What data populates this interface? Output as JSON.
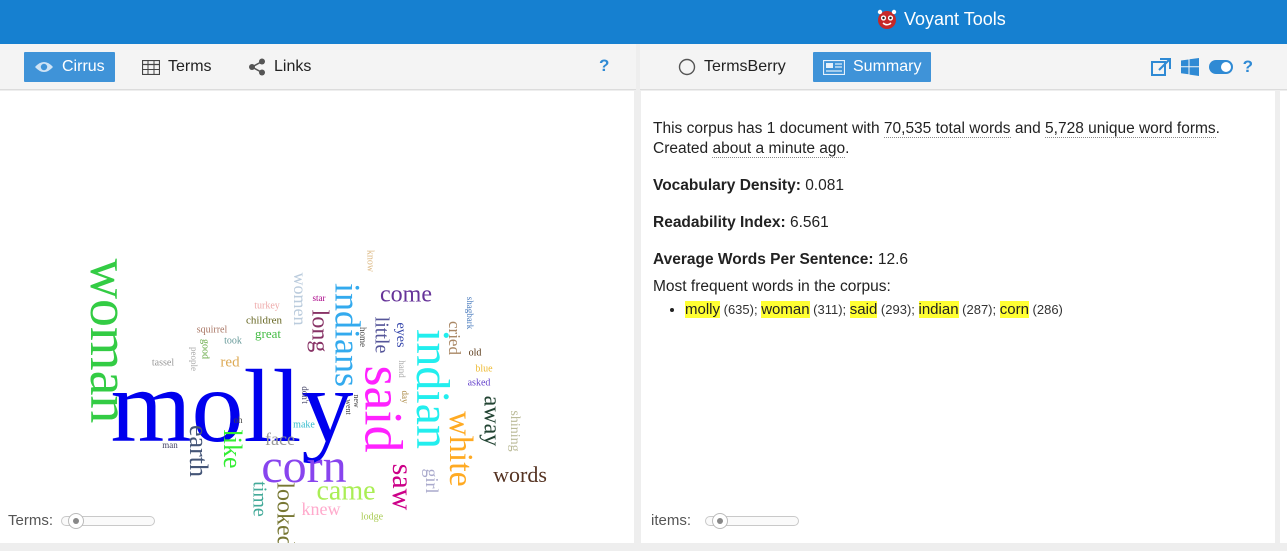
{
  "app": {
    "title": "Voyant Tools"
  },
  "left_toolbar": {
    "tabs": [
      {
        "label": "Cirrus",
        "active": true,
        "icon": "eye-icon"
      },
      {
        "label": "Terms",
        "active": false,
        "icon": "table-icon"
      },
      {
        "label": "Links",
        "active": false,
        "icon": "share-icon"
      }
    ],
    "help": "?"
  },
  "right_toolbar": {
    "tabs": [
      {
        "label": "TermsBerry",
        "active": false,
        "icon": "circle-icon"
      },
      {
        "label": "Summary",
        "active": true,
        "icon": "newspaper-icon"
      }
    ],
    "icons": [
      "export-icon",
      "windows-icon",
      "toggle-icon",
      "help-icon"
    ],
    "help": "?"
  },
  "cirrus": {
    "slider_label": "Terms:",
    "slider_value": 0.05,
    "words": [
      {
        "text": "molly",
        "color": "#0000ee"
      },
      {
        "text": "woman",
        "color": "#33cc44"
      },
      {
        "text": "said",
        "color": "#ff22ff"
      },
      {
        "text": "indian",
        "color": "#22eeee"
      },
      {
        "text": "corn",
        "color": "#8844ee"
      },
      {
        "text": "indians",
        "color": "#33aaee"
      },
      {
        "text": "white",
        "color": "#ffaa22"
      },
      {
        "text": "saw",
        "color": "#cc0088"
      },
      {
        "text": "came",
        "color": "#aaee55"
      },
      {
        "text": "like",
        "color": "#33ee33"
      },
      {
        "text": "earth",
        "color": "#445577"
      },
      {
        "text": "long",
        "color": "#883366"
      },
      {
        "text": "looked",
        "color": "#777733"
      },
      {
        "text": "come",
        "color": "#663399"
      },
      {
        "text": "words",
        "color": "#553322"
      },
      {
        "text": "away",
        "color": "#224433"
      },
      {
        "text": "little",
        "color": "#555599"
      },
      {
        "text": "face",
        "color": "#999999"
      },
      {
        "text": "time",
        "color": "#44aa99"
      },
      {
        "text": "knew",
        "color": "#ffaacc"
      },
      {
        "text": "girl",
        "color": "#aaaacc"
      },
      {
        "text": "cried",
        "color": "#aa8866"
      },
      {
        "text": "women",
        "color": "#bbccdd"
      },
      {
        "text": "eyes",
        "color": "#3344aa"
      },
      {
        "text": "shining",
        "color": "#bbbb99"
      },
      {
        "text": "red",
        "color": "#ddaa55"
      },
      {
        "text": "great",
        "color": "#44bb44"
      },
      {
        "text": "children",
        "color": "#666622"
      },
      {
        "text": "turkey",
        "color": "#eeaaaa"
      },
      {
        "text": "squirrel",
        "color": "#aa7766"
      },
      {
        "text": "took",
        "color": "#669999"
      },
      {
        "text": "good",
        "color": "#66aa44"
      },
      {
        "text": "people",
        "color": "#aaaaaa"
      },
      {
        "text": "tassel",
        "color": "#999999"
      },
      {
        "text": "star",
        "color": "#aa0088"
      },
      {
        "text": "home",
        "color": "#444444"
      },
      {
        "text": "hand",
        "color": "#aaaaaa"
      },
      {
        "text": "day",
        "color": "#aa8844"
      },
      {
        "text": "know",
        "color": "#ddbb88"
      },
      {
        "text": "shagbark",
        "color": "#4477bb"
      },
      {
        "text": "old",
        "color": "#553311"
      },
      {
        "text": "blue",
        "color": "#eebb33"
      },
      {
        "text": "asked",
        "color": "#6644cc"
      },
      {
        "text": "don't",
        "color": "#444466"
      },
      {
        "text": "new",
        "color": "#444444"
      },
      {
        "text": "went",
        "color": "#444444"
      },
      {
        "text": "make",
        "color": "#33bbcc"
      },
      {
        "text": "oh",
        "color": "#444444"
      },
      {
        "text": "man",
        "color": "#444466"
      },
      {
        "text": "lodge",
        "color": "#aacc55"
      }
    ]
  },
  "summary": {
    "line1_a": "This corpus has 1 document with ",
    "total_words": "70,535 total words",
    "line1_b": " and ",
    "unique_words": "5,728 unique word forms",
    "line1_c": ".",
    "created_a": "Created ",
    "created_when": "about a minute ago",
    "created_b": ".",
    "vocab_label": "Vocabulary Density:",
    "vocab_value": "0.081",
    "read_label": "Readability Index:",
    "read_value": "6.561",
    "avg_label": "Average Words Per Sentence:",
    "avg_value": "12.6",
    "freq_label": "Most frequent words in the corpus:",
    "freq_items": [
      {
        "word": "molly",
        "count": "(635)"
      },
      {
        "word": "woman",
        "count": "(311)"
      },
      {
        "word": "said",
        "count": "(293)"
      },
      {
        "word": "indian",
        "count": "(287)"
      },
      {
        "word": "corn",
        "count": "(286)"
      }
    ],
    "slider_label": "items:",
    "slider_value": 0.05
  }
}
